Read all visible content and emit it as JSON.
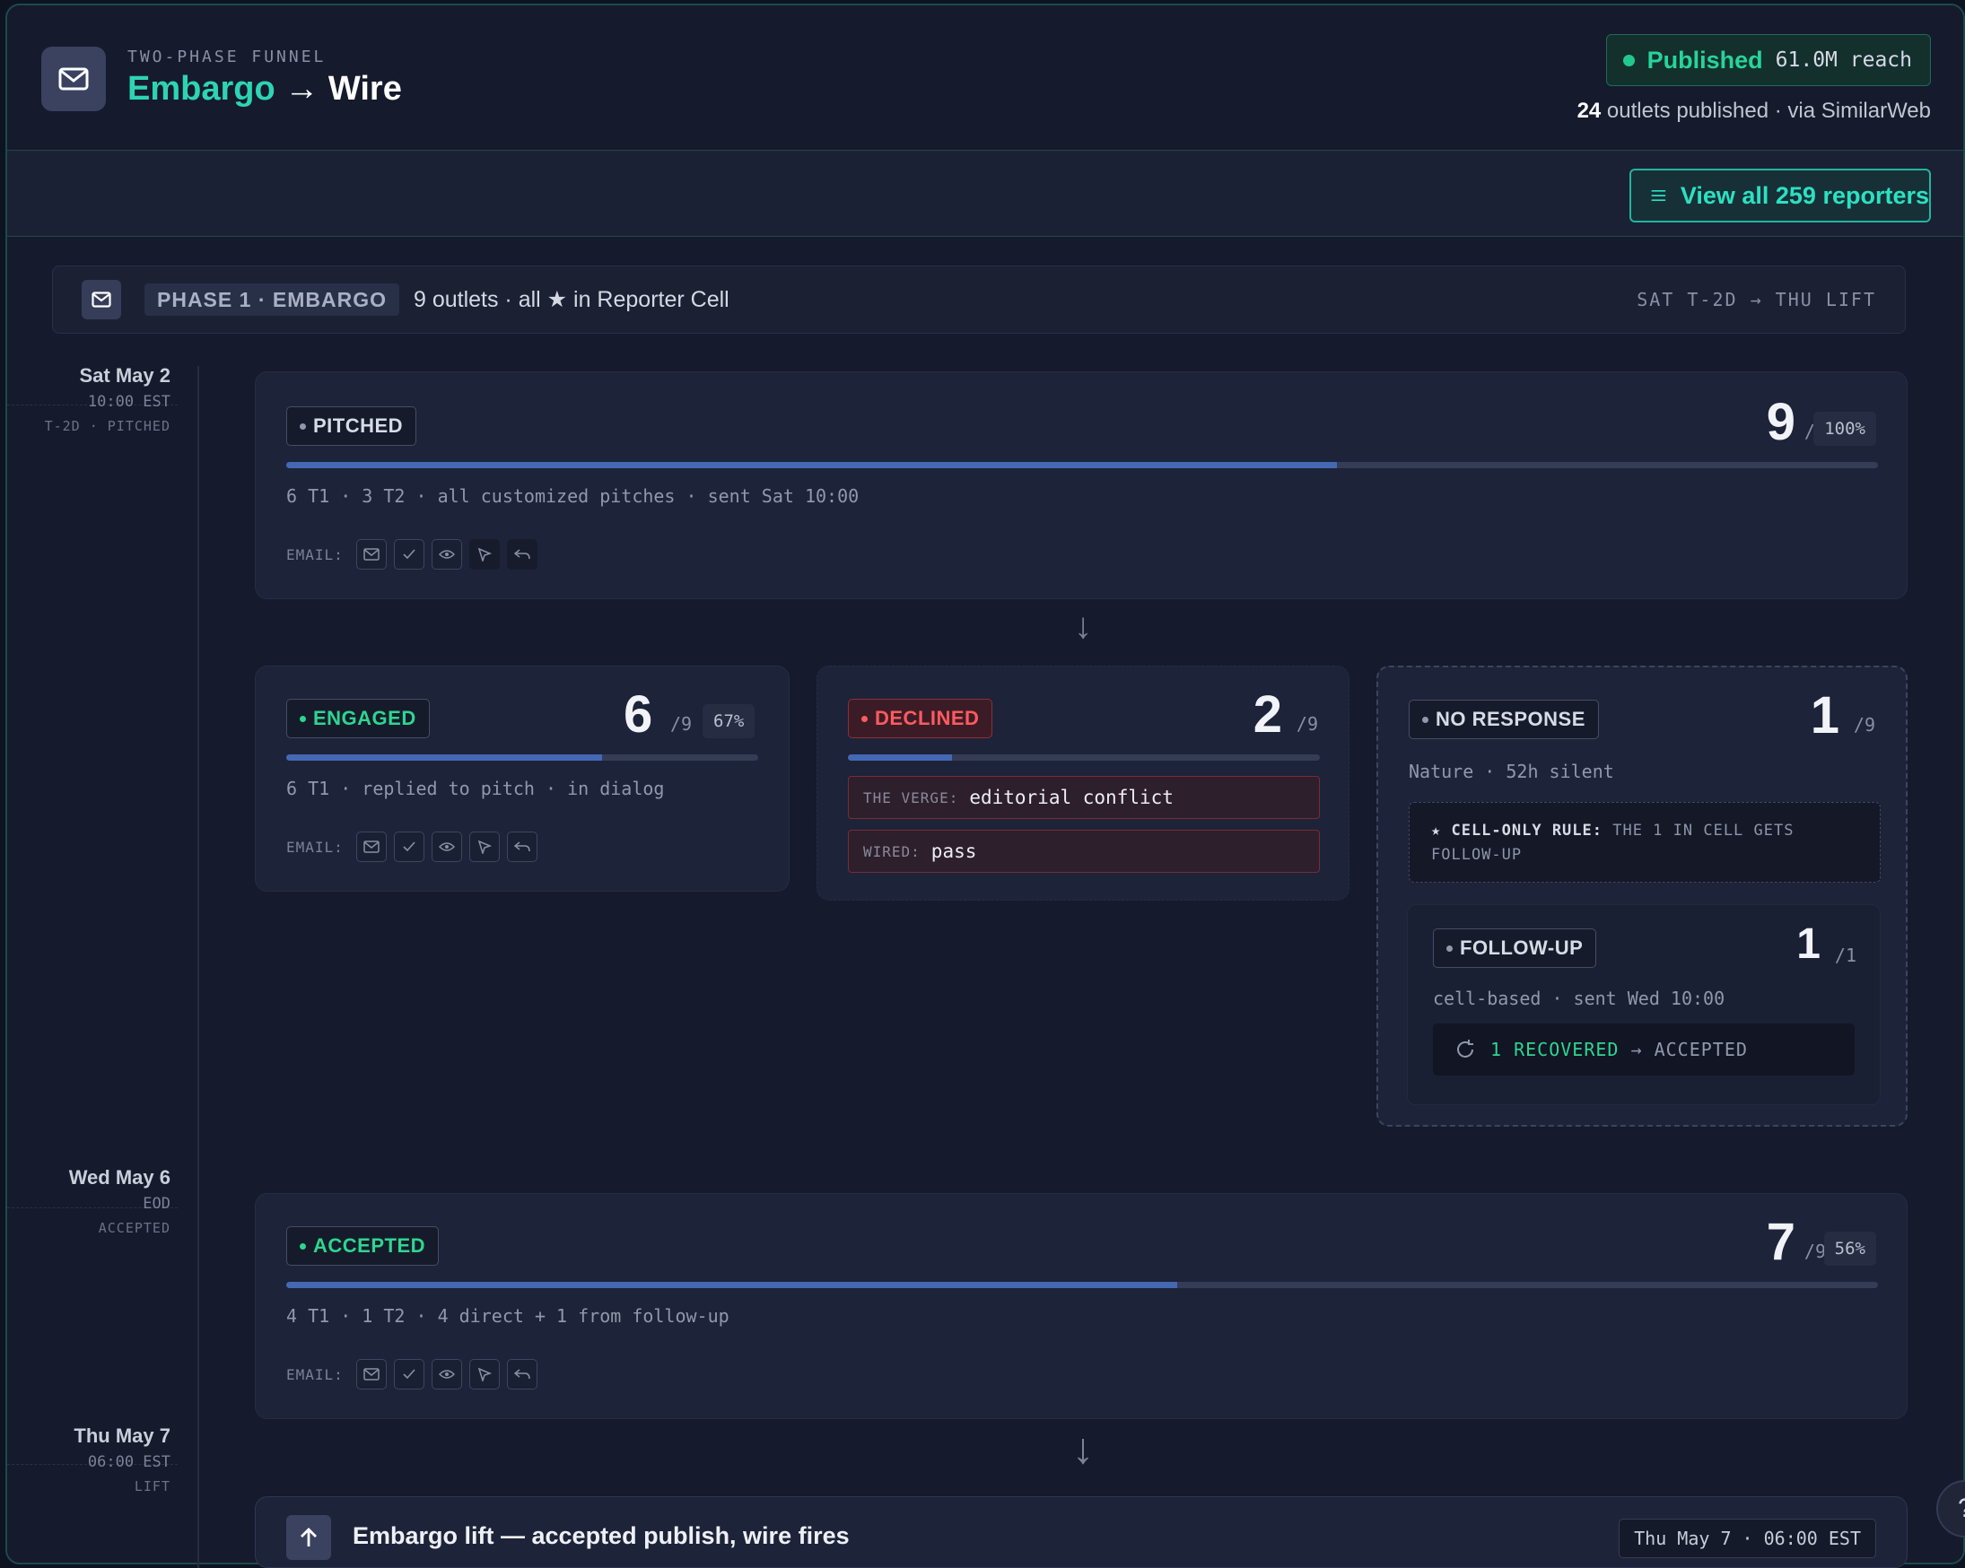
{
  "header": {
    "eyebrow": "TWO-PHASE FUNNEL",
    "title_a": "Embargo",
    "title_arrow": " → ",
    "title_b": "Wire",
    "status_label": "Published",
    "reach": "61.0M reach",
    "outlets_count": "24",
    "outlets_text": " outlets published · via SimilarWeb",
    "view_all_label": "View all 259 reporters"
  },
  "phase": {
    "tag": "PHASE 1 · EMBARGO",
    "description": "9 outlets · all ★ in Reporter Cell",
    "range": "SAT T-2D → THU LIFT"
  },
  "timeline": [
    {
      "date": "Sat May 2",
      "time": "10:00 EST",
      "stage": "T-2D · PITCHED"
    },
    {
      "date": "Wed May 6",
      "time": "EOD",
      "stage": "ACCEPTED"
    },
    {
      "date": "Thu May 7",
      "time": "06:00 EST",
      "stage": "LIFT"
    }
  ],
  "email_label": "EMAIL:",
  "pitched": {
    "badge": "PITCHED",
    "count": "9",
    "den": "/9",
    "pct": "100%",
    "progress": 0.66,
    "detail": "6 T1 · 3 T2 · all customized pitches · sent Sat 10:00"
  },
  "engaged": {
    "badge": "ENGAGED",
    "count": "6",
    "den": "/9",
    "pct": "67%",
    "progress": 0.67,
    "detail": "6 T1 · replied to pitch · in dialog"
  },
  "declined": {
    "badge": "DECLINED",
    "count": "2",
    "den": "/9",
    "progress": 0.22,
    "reasons": [
      {
        "key": "THE VERGE:",
        "value": "editorial conflict"
      },
      {
        "key": "WIRED:",
        "value": "pass"
      }
    ]
  },
  "no_response": {
    "badge": "NO RESPONSE",
    "count": "1",
    "den": "/9",
    "detail": "Nature · 52h silent",
    "rule_key": "★ CELL-ONLY RULE:",
    "rule_text": " THE 1 IN CELL GETS FOLLOW-UP"
  },
  "follow_up": {
    "badge": "FOLLOW-UP",
    "count": "1",
    "den": "/1",
    "detail": "cell-based · sent Wed 10:00",
    "recovered": "1 RECOVERED",
    "recovered_to": " → ACCEPTED"
  },
  "accepted": {
    "badge": "ACCEPTED",
    "count": "7",
    "den": "/9",
    "pct": "56%",
    "progress": 0.56,
    "detail": "4 T1 · 1 T2 · 4 direct + 1 from follow-up"
  },
  "lift": {
    "text": "Embargo lift — accepted publish, wire fires",
    "when": "Thu May 7 · 06:00 EST"
  },
  "help_label": "?",
  "colors": {
    "accent": "#2dd4b4",
    "success": "#2fd58f",
    "danger": "#ff5a5f",
    "progress": "#4468b4"
  }
}
